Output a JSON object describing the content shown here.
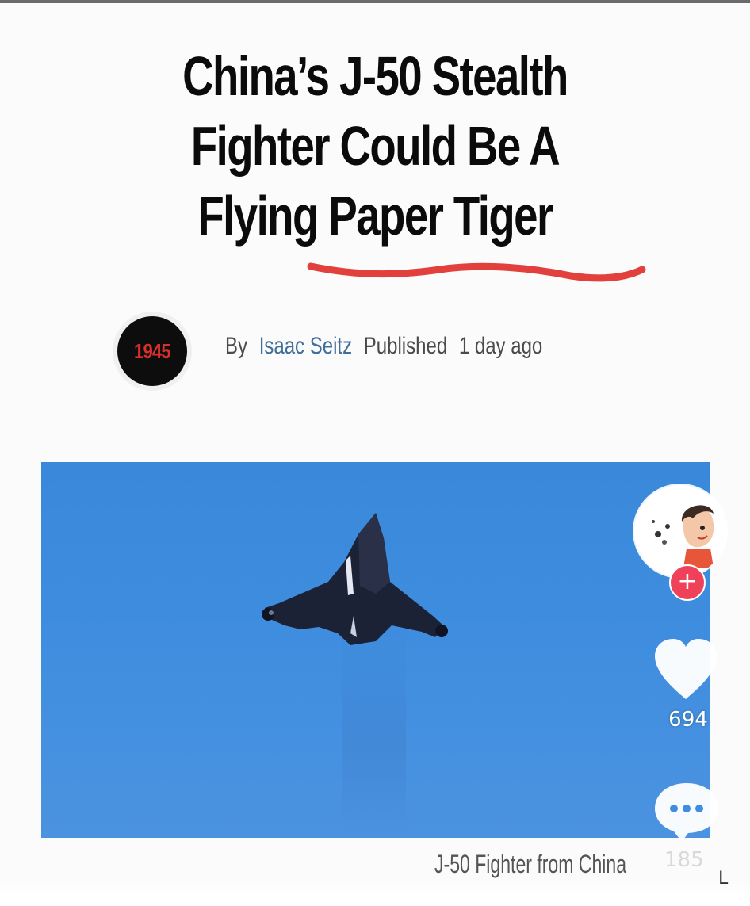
{
  "article": {
    "headline_line1": "China’s J-50 Stealth",
    "headline_line2": "Fighter Could Be A",
    "headline_line3": "Flying Paper Tiger",
    "publisher_logo_text": "1945",
    "byline_prefix": "By",
    "author": "Isaac Seitz",
    "published_label": "Published",
    "published_time": "1 day ago"
  },
  "video": {
    "caption": "J-50 Fighter from China",
    "like_count": "694",
    "comment_count": "185",
    "follow_symbol": "+",
    "corner_glyph": "L"
  },
  "icons": {
    "heart": "heart-icon",
    "comment": "comment-bubble-icon",
    "follow": "plus-icon"
  },
  "colors": {
    "headline": "#0b0b0b",
    "author_link": "#3f6f9a",
    "logo_text": "#d4312c",
    "logo_bg": "#0d0d0d",
    "sky": "#3f8ddf",
    "squiggle": "#e2403d",
    "follow_badge": "#f0415a"
  }
}
